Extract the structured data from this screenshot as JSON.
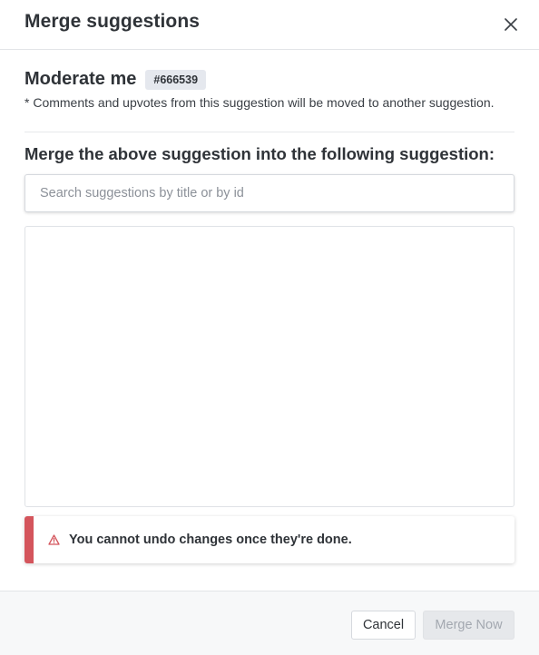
{
  "dialog": {
    "title": "Merge suggestions",
    "close_icon": "close-icon"
  },
  "source": {
    "title": "Moderate me",
    "id_badge": "#666539",
    "note": "* Comments and upvotes from this suggestion will be moved to another suggestion."
  },
  "merge": {
    "label": "Merge the above suggestion into the following suggestion:",
    "search_placeholder": "Search suggestions by title or by id",
    "search_value": "",
    "results": []
  },
  "warning": {
    "icon": "warning-triangle-icon",
    "text": "You cannot undo changes once they're done.",
    "accent_color": "#d4555c"
  },
  "footer": {
    "cancel_label": "Cancel",
    "merge_label": "Merge Now",
    "merge_disabled": true
  }
}
